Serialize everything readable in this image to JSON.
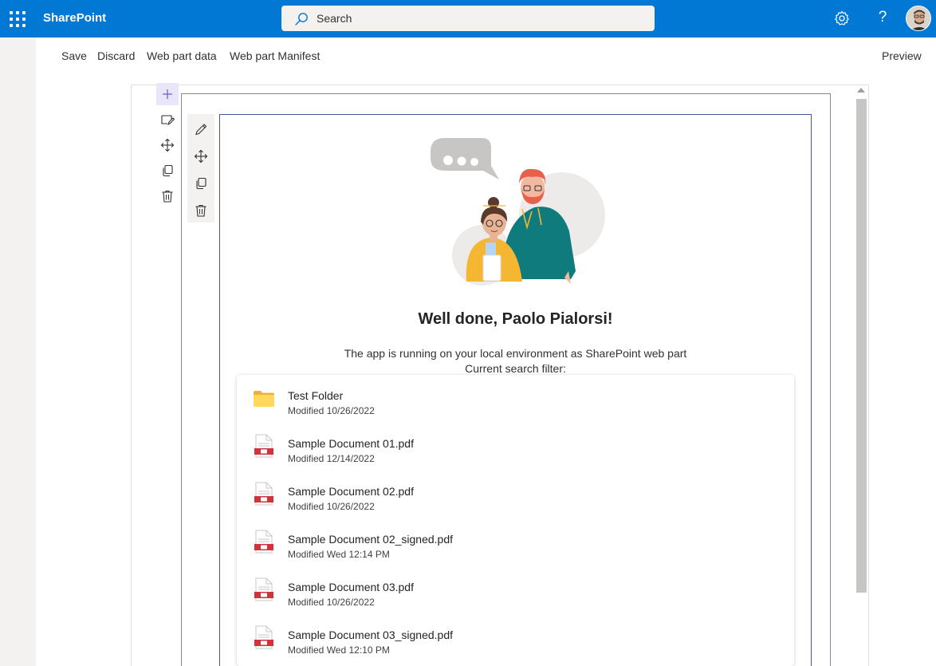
{
  "suitebar": {
    "brand": "SharePoint",
    "search_placeholder": "Search",
    "help_label": "?"
  },
  "commands": {
    "save": "Save",
    "discard": "Discard",
    "webpart_data": "Web part data",
    "webpart_manifest": "Web part Manifest",
    "preview": "Preview"
  },
  "webpart": {
    "heading": "Well done, Paolo Pialorsi!",
    "line1": "The app is running on your local environment as SharePoint web part",
    "line2": "Current search filter:"
  },
  "files": [
    {
      "name": "Test Folder",
      "modified": "Modified 10/26/2022",
      "icon": "folder-icon"
    },
    {
      "name": "Sample Document 01.pdf",
      "modified": "Modified 12/14/2022",
      "icon": "pdf-icon"
    },
    {
      "name": "Sample Document 02.pdf",
      "modified": "Modified 10/26/2022",
      "icon": "pdf-icon"
    },
    {
      "name": "Sample Document 02_signed.pdf",
      "modified": "Modified Wed 12:14 PM",
      "icon": "pdf-icon"
    },
    {
      "name": "Sample Document 03.pdf",
      "modified": "Modified 10/26/2022",
      "icon": "pdf-icon"
    },
    {
      "name": "Sample Document 03_signed.pdf",
      "modified": "Modified Wed 12:10 PM",
      "icon": "pdf-icon"
    }
  ],
  "colors": {
    "suitebar": "#0078d4",
    "accent_teal": "#0f7b7d",
    "accent_yellow": "#f5b731",
    "pdf_red": "#d13438"
  }
}
